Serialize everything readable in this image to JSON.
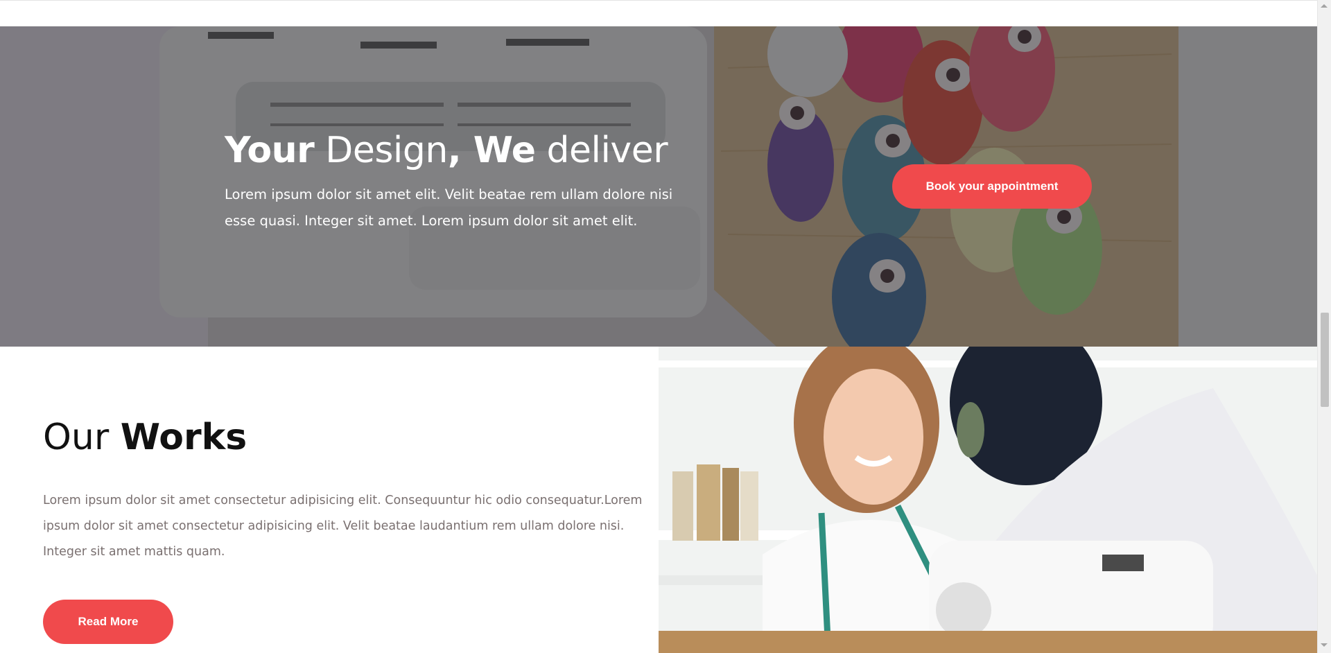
{
  "hero": {
    "title_strong_1": "Your",
    "title_light_1": " Design",
    "title_strong_2": ", We",
    "title_light_2": " deliver",
    "text": "Lorem ipsum dolor sit amet elit. Velit beatae rem ullam dolore nisi esse quasi. Integer sit amet. Lorem ipsum dolor sit amet elit.",
    "cta_label": "Book your appointment"
  },
  "works": {
    "title_light": "Our ",
    "title_strong": "Works",
    "text": "Lorem ipsum dolor sit amet consectetur adipisicing elit. Consequuntur hic odio consequatur.Lorem ipsum dolor sit amet consectetur adipisicing elit. Velit beatae laudantium rem ullam dolore nisi. Integer sit amet mattis quam.",
    "button_label": "Read More"
  },
  "colors": {
    "accent": "#f04a4c",
    "overlay": "#28282c",
    "body_text": "#7a7070",
    "heading": "#111111"
  },
  "images": {
    "hero": "sewing-machine-and-thread-spools-photo",
    "works": "smiling-seamstress-with-measuring-tape-photo"
  }
}
